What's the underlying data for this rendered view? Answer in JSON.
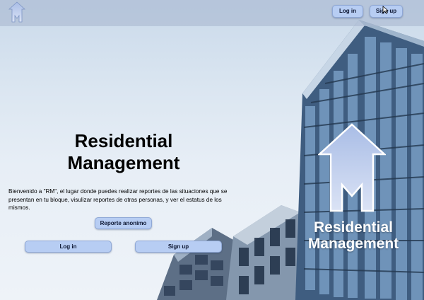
{
  "header": {
    "logo_icon": "house-m-icon",
    "login_label": "Log in",
    "signup_label": "Sign up"
  },
  "hero": {
    "title": "Residential Management",
    "description": "Bienvenido a \"RM\", el lugar donde puedes realizar reportes de las situaciones que se presentan en tu bloque, visulizar reportes de otras personas, y ver el estatus de los mismos.",
    "report_button": "Reporte anonimo",
    "login_button": "Log in",
    "signup_button": "Sign up"
  },
  "branding": {
    "logo_icon": "house-m-icon",
    "title": "Residential Management"
  },
  "colors": {
    "button_bg": "#b7cdf3",
    "header_bg": "#a5b4cd",
    "logo_gradient_top": "#a9bde6",
    "logo_gradient_bottom": "#dbe3f5"
  }
}
